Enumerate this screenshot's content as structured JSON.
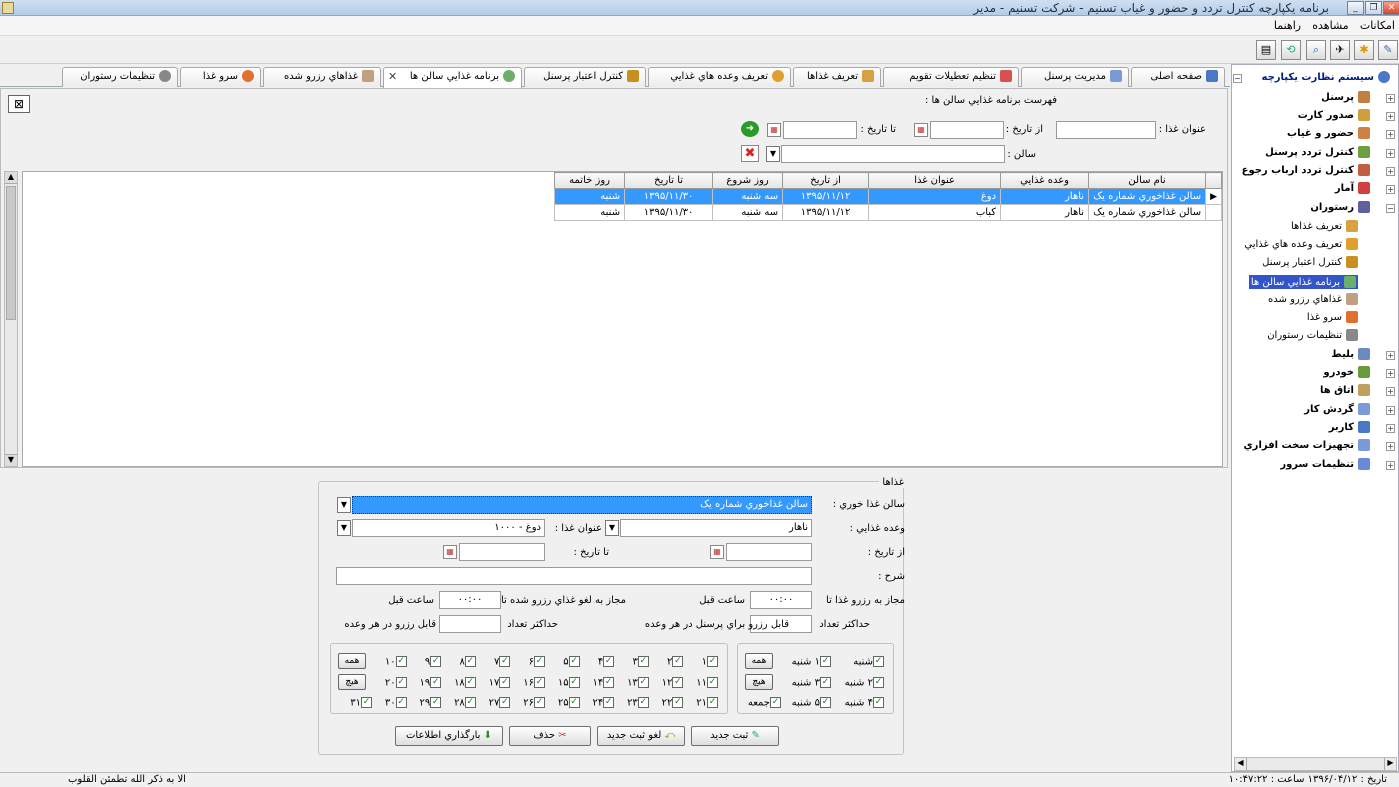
{
  "window": {
    "title": "برنامه یکپارچه کنترل تردد و حضور و غیاب تسنیم - شرکت تسنیم - مدیر"
  },
  "menu": [
    "امکانات",
    "مشاهده",
    "راهنما"
  ],
  "tabs": [
    "صفحه اصلی",
    "مدیریت پرسنل",
    "تنظیم تعطیلات تقویم",
    "تعریف غذاها",
    "تعریف وعده هاي غذايي",
    "کنترل اعتبار پرسنل",
    "برنامه غذايي سالن ها",
    "غذاهاي رزرو شده",
    "سرو غذا",
    "تنظيمات رستوران"
  ],
  "list": {
    "title": "فهرست برنامه غذايي سالن ها :",
    "food_title_label": "عنوان غذا :",
    "from_date_label": "از تاريخ :",
    "to_date_label": "تا تاريخ :",
    "hall_label": "سالن :",
    "columns": [
      "نام سالن",
      "وعده غذايي",
      "عنوان غذا",
      "از تاريخ",
      "روز شروع",
      "تا تاريخ",
      "روز خاتمه"
    ],
    "rows": [
      [
        "سالن غذاخوري شماره يک",
        "ناهار",
        "دوغ",
        "۱۳۹۵/۱۱/۱۲",
        "سه شنبه",
        "۱۳۹۵/۱۱/۳۰",
        "شنبه"
      ],
      [
        "سالن غذاخوري شماره يک",
        "ناهار",
        "کباب",
        "۱۳۹۵/۱۱/۱۲",
        "سه شنبه",
        "۱۳۹۵/۱۱/۳۰",
        "شنبه"
      ]
    ]
  },
  "form": {
    "group_title": "غذاها",
    "hall_label": "سالن غذا خوري :",
    "hall_value": "سالن غذاخوري شماره يک",
    "meal_label": "وعده غذايي :",
    "meal_value": "ناهار",
    "food_label": "عنوان غذا :",
    "food_value": "دوغ - ۱۰۰۰",
    "from_label": "از تاريخ :",
    "to_label": "تا تاريخ :",
    "desc_label": "شرح :",
    "reserve_until_label": "مجاز به رزرو غذا تا",
    "reserve_until_value": "۰۰:۰۰",
    "hours_before_1": "ساعت قبل",
    "cancel_label": "مجاز به لغو غذاي رزرو شده تا",
    "cancel_value": "۰۰:۰۰",
    "hours_before_2": "ساعت قبل",
    "max_count_label_1": "حداکثر تعداد",
    "max_count_desc_1": "قابل رزرو براي پرسنل در هر وعده",
    "max_count_label_2": "حداکثر تعداد",
    "max_count_desc_2": "قابل رزرو در هر وعده",
    "weekdays": [
      "شنبه",
      "۱ شنبه",
      "۲ شنبه",
      "۳ شنبه",
      "۴ شنبه",
      "۵ شنبه",
      "جمعه"
    ],
    "all_label": "همه",
    "none_label": "هيچ",
    "days": [
      "۱",
      "۲",
      "۳",
      "۴",
      "۵",
      "۶",
      "۷",
      "۸",
      "۹",
      "۱۰",
      "۱۱",
      "۱۲",
      "۱۳",
      "۱۴",
      "۱۵",
      "۱۶",
      "۱۷",
      "۱۸",
      "۱۹",
      "۲۰",
      "۲۱",
      "۲۲",
      "۲۳",
      "۲۴",
      "۲۵",
      "۲۶",
      "۲۷",
      "۲۸",
      "۲۹",
      "۳۰",
      "۳۱"
    ],
    "buttons": {
      "new": "ثبت جديد",
      "cancel_new": "لغو ثبت جديد",
      "delete": "حذف",
      "reload": "بارگذاري اطلاعات"
    }
  },
  "tree": {
    "root": "سيستم نظارت يکپارچه",
    "items": [
      "پرسنل",
      "صدور کارت",
      "حضور و غياب",
      "کنترل تردد پرسنل",
      "کنترل تردد ارباب رجوع",
      "آمار",
      "رستوران"
    ],
    "children": [
      "تعريف غذاها",
      "تعريف وعده هاي غذايي",
      "کنترل اعتبار پرسنل",
      "برنامه غذايي سالن ها",
      "غذاهاي رزرو شده",
      "سرو غذا",
      "تنظيمات رستوران"
    ],
    "items2": [
      "بليط",
      "خودرو",
      "اتاق ها",
      "گردش کار",
      "کاربر",
      "تجهيزات سخت افزاري",
      "تنظيمات سرور"
    ]
  },
  "status": {
    "left": "الا به ذکر الله تطمئن القلوب",
    "right": "تاريخ : ۱۳۹۶/۰۴/۱۲ ساعت : ۱۰:۴۷:۲۲"
  },
  "colors": {
    "selection": "#3399ff",
    "tree_selected": "#3355cc"
  }
}
